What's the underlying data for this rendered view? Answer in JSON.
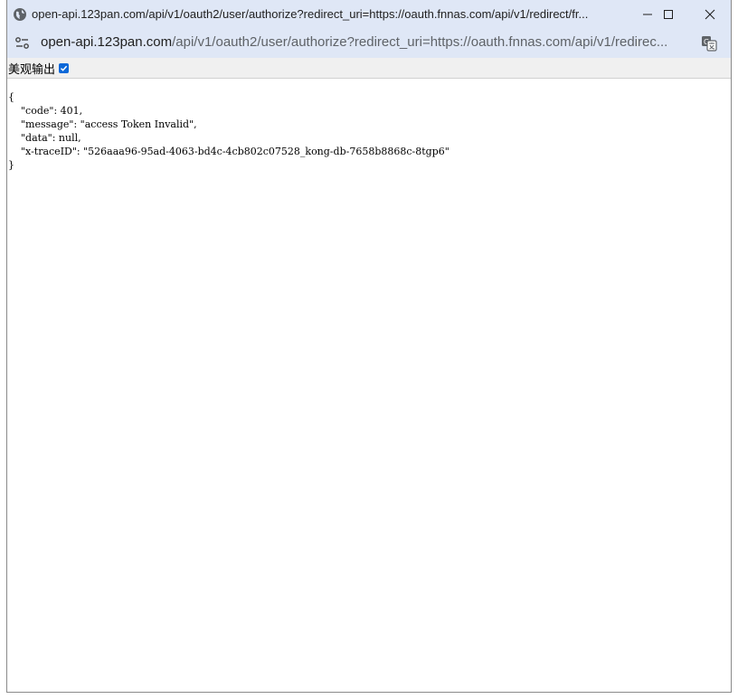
{
  "titlebar": {
    "title": "open-api.123pan.com/api/v1/oauth2/user/authorize?redirect_uri=https://oauth.fnnas.com/api/v1/redirect/fr..."
  },
  "addressbar": {
    "url_host": "open-api.123pan.com",
    "url_rest": "/api/v1/oauth2/user/authorize?redirect_uri=https://oauth.fnnas.com/api/v1/redirec..."
  },
  "toolbar": {
    "pretty_print_label": "美观输出",
    "pretty_print_checked": true
  },
  "json": {
    "open": "{",
    "lines": [
      "\"code\": 401,",
      "\"message\": \"access Token Invalid\",",
      "\"data\": null,",
      "\"x-traceID\": \"526aaa96-95ad-4063-bd4c-4cb802c07528_kong-db-7658b8868c-8tgp6\""
    ],
    "close": "}"
  },
  "icons": {
    "globe": "globe-icon",
    "minimize": "minimize-icon",
    "maximize": "maximize-icon",
    "close": "close-icon",
    "site_info": "site-info-icon",
    "translate": "translate-icon",
    "checkmark": "checkmark-icon"
  },
  "colors": {
    "frame": "#dfe7f6",
    "checkbox": "#0b68d8"
  }
}
